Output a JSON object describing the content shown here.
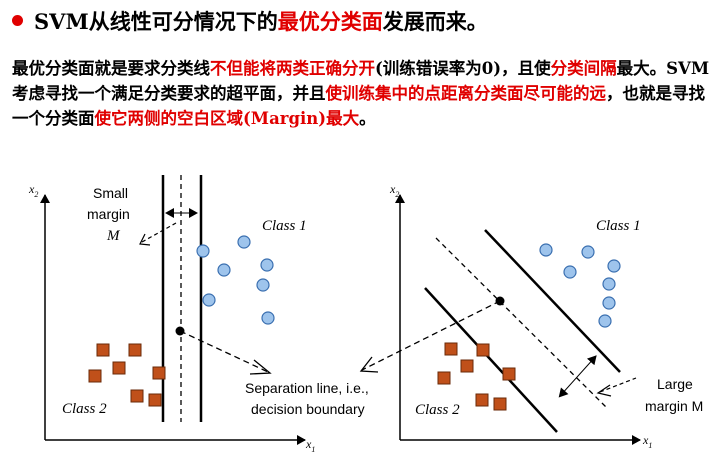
{
  "title": {
    "prefix": "SVM从线性可分情况下的",
    "highlight": "最优分类面",
    "suffix": "发展而来。"
  },
  "paragraph": {
    "p1": "最优分类面就是要求分类线",
    "r1": "不但能将两类正确分开",
    "p2": "(训练错误率为0)，且使",
    "r2": "分类间隔",
    "p3": "最大。SVM考虑寻找一个满足分类要求的超平面，并且",
    "r3": "使训练集中的点距离分类面尽可能的远",
    "p4": "，也就是寻找一个分类面",
    "r4": "使它两侧的空白区域(Margin)最大",
    "p5": "。"
  },
  "left_figure": {
    "axis_x": "x",
    "axis_x_sub": "1",
    "axis_y": "x",
    "axis_y_sub": "2",
    "small_margin_line1": "Small",
    "small_margin_line2": "margin",
    "margin_symbol": "M",
    "class1": "Class 1",
    "class2": "Class 2"
  },
  "center_label": {
    "line1": "Separation line, i.e.,",
    "line2": "decision boundary"
  },
  "right_figure": {
    "axis_x": "x",
    "axis_x_sub": "1",
    "axis_y": "x",
    "axis_y_sub": "2",
    "large_margin_line1": "Large",
    "large_margin_line2": "margin M",
    "class1": "Class 1",
    "class2": "Class 2"
  },
  "colors": {
    "red": "#e00000",
    "circle_fill": "#9ec4ec",
    "circle_stroke": "#3a6fb0",
    "square_fill": "#c0501a",
    "square_stroke": "#6a2a08"
  }
}
